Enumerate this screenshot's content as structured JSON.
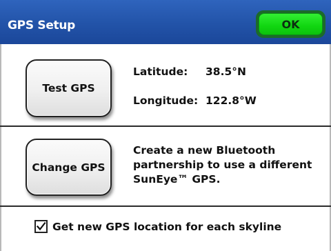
{
  "window": {
    "title": "GPS Setup",
    "ok_label": "OK"
  },
  "gps": {
    "test_button_label": "Test GPS",
    "latitude_label": "Latitude:",
    "latitude_value": "38.5°N",
    "longitude_label": "Longitude:",
    "longitude_value": "122.8°W"
  },
  "change": {
    "button_label": "Change GPS",
    "description": "Create a new Bluetooth partnership to use a different SunEye™ GPS."
  },
  "options": {
    "new_location_label": "Get new GPS location for each skyline",
    "new_location_checked": true
  },
  "colors": {
    "titlebar": "#2253a8",
    "ok_green": "#10d610"
  },
  "icons": {
    "checkbox": "check-icon"
  }
}
